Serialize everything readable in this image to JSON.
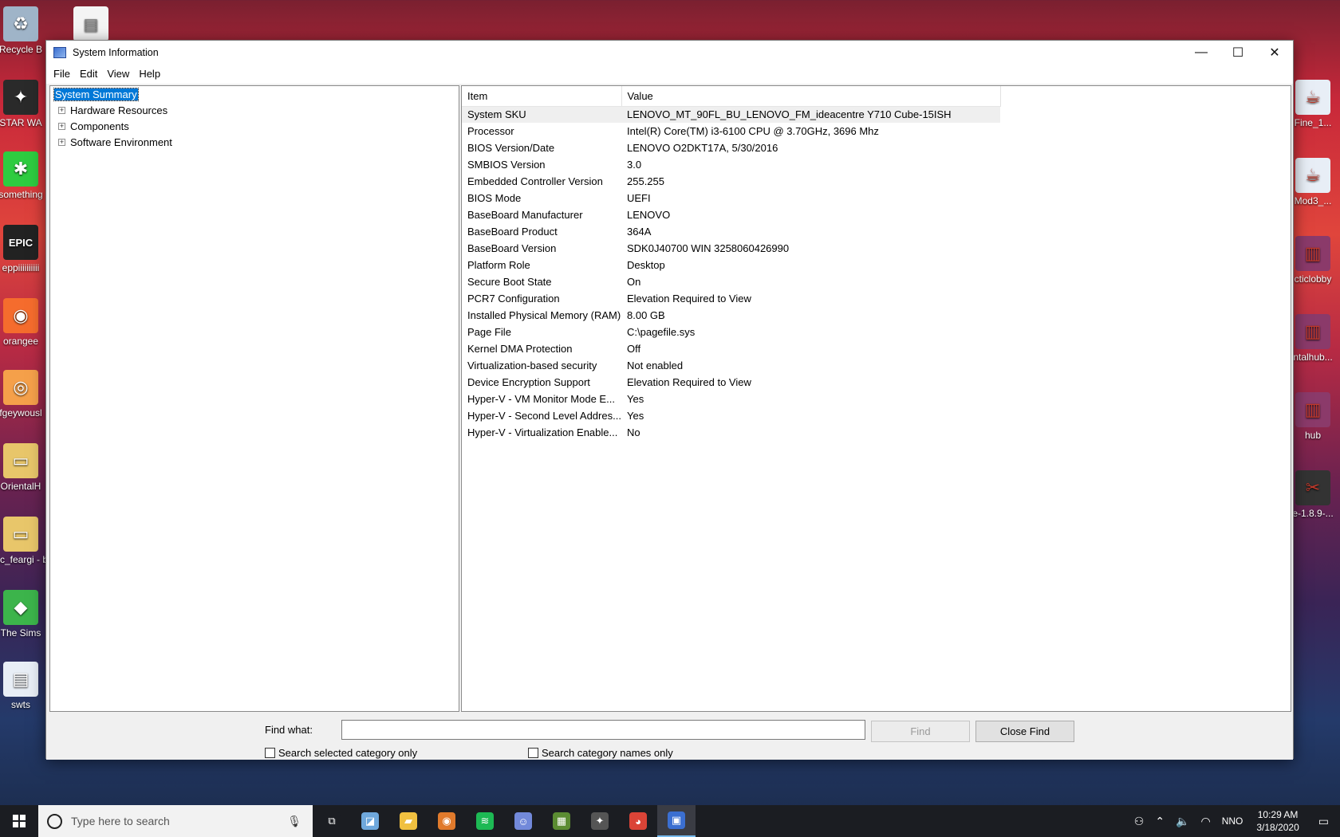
{
  "desktop": {
    "left_icons": [
      {
        "label": "Recycle B",
        "icon": "recycle-bin-icon",
        "color": "#9fb4c8",
        "glyph": "♻"
      },
      {
        "label": "STAR WA",
        "icon": "star-wars-icon",
        "color": "#2a2a2a",
        "glyph": "✦"
      },
      {
        "label": "something",
        "icon": "shortcut-app-icon",
        "color": "#2ecc40",
        "glyph": "✱"
      },
      {
        "label": "eppiiiiiiiiii",
        "icon": "epic-games-icon",
        "color": "#222222",
        "glyph": "EPIC"
      },
      {
        "label": "orangee",
        "icon": "origin-icon",
        "color": "#f56c2d",
        "glyph": "◉"
      },
      {
        "label": "fgeywousl",
        "icon": "swirl-app-icon",
        "color": "#f5a04a",
        "glyph": "◎"
      },
      {
        "label": "OrientalH",
        "icon": "folder-icon",
        "color": "#e8c66a",
        "glyph": "▭"
      },
      {
        "label": "mc_feargi - bedwars",
        "icon": "folder-icon",
        "color": "#e8c66a",
        "glyph": "▭"
      },
      {
        "label": "The Sims",
        "icon": "sims-icon",
        "color": "#3cb44b",
        "glyph": "◆"
      },
      {
        "label": "swts",
        "icon": "document-icon",
        "color": "#e8eef6",
        "glyph": "▤"
      }
    ],
    "top_icon": {
      "icon": "text-file-icon"
    },
    "right_icons": [
      {
        "label": "Fine_1...",
        "icon": "java-file-icon",
        "color": "#e8eef6",
        "glyph": "☕"
      },
      {
        "label": "Mod3_...",
        "icon": "java-file-icon",
        "color": "#e8eef6",
        "glyph": "☕"
      },
      {
        "label": "cticlobby",
        "icon": "winrar-archive-icon",
        "color": "#8b3a6a",
        "glyph": "▥"
      },
      {
        "label": "ntalhub...",
        "icon": "winrar-archive-icon",
        "color": "#8b3a6a",
        "glyph": "▥"
      },
      {
        "label": "hub",
        "icon": "winrar-archive-icon",
        "color": "#8b3a6a",
        "glyph": "▥"
      },
      {
        "label": "e-1.8.9-...",
        "icon": "jar-file-icon",
        "color": "#333333",
        "glyph": "✂"
      }
    ]
  },
  "window": {
    "title": "System Information",
    "menu": [
      "File",
      "Edit",
      "View",
      "Help"
    ],
    "controls": {
      "minimize": "—",
      "maximize": "☐",
      "close": "✕"
    }
  },
  "tree": {
    "items": [
      {
        "label": "System Summary",
        "selected": true,
        "expandable": false
      },
      {
        "label": "Hardware Resources",
        "selected": false,
        "expandable": true
      },
      {
        "label": "Components",
        "selected": false,
        "expandable": true
      },
      {
        "label": "Software Environment",
        "selected": false,
        "expandable": true
      }
    ]
  },
  "details": {
    "columns": [
      "Item",
      "Value"
    ],
    "rows": [
      [
        "System SKU",
        "LENOVO_MT_90FL_BU_LENOVO_FM_ideacentre Y710 Cube-15ISH"
      ],
      [
        "Processor",
        "Intel(R) Core(TM) i3-6100 CPU @ 3.70GHz, 3696 Mhz"
      ],
      [
        "BIOS Version/Date",
        "LENOVO O2DKT17A, 5/30/2016"
      ],
      [
        "SMBIOS Version",
        "3.0"
      ],
      [
        "Embedded Controller Version",
        "255.255"
      ],
      [
        "BIOS Mode",
        "UEFI"
      ],
      [
        "BaseBoard Manufacturer",
        "LENOVO"
      ],
      [
        "BaseBoard Product",
        "364A"
      ],
      [
        "BaseBoard Version",
        "SDK0J40700 WIN 3258060426990"
      ],
      [
        "Platform Role",
        "Desktop"
      ],
      [
        "Secure Boot State",
        "On"
      ],
      [
        "PCR7 Configuration",
        "Elevation Required to View"
      ],
      [
        "Installed Physical Memory (RAM)",
        "8.00 GB"
      ],
      [
        "Page File",
        "C:\\pagefile.sys"
      ],
      [
        "Kernel DMA Protection",
        "Off"
      ],
      [
        "Virtualization-based security",
        "Not enabled"
      ],
      [
        "Device Encryption Support",
        "Elevation Required to View"
      ],
      [
        "Hyper-V - VM Monitor Mode E...",
        "Yes"
      ],
      [
        "Hyper-V - Second Level Addres...",
        "Yes"
      ],
      [
        "Hyper-V - Virtualization Enable...",
        "No"
      ]
    ]
  },
  "find": {
    "label": "Find what:",
    "value": "",
    "find_button": "Find",
    "close_button": "Close Find",
    "check_selected": "Search selected category only",
    "check_names": "Search category names only"
  },
  "taskbar": {
    "search_placeholder": "Type here to search",
    "apps": [
      {
        "icon": "task-view-icon",
        "glyph": "⧉",
        "color": "#1b1d22"
      },
      {
        "icon": "notes-app-icon",
        "glyph": "◪",
        "color": "#6fa8dc"
      },
      {
        "icon": "file-explorer-icon",
        "glyph": "▰",
        "color": "#f0c040"
      },
      {
        "icon": "groove-music-icon",
        "glyph": "◉",
        "color": "#e07a2c"
      },
      {
        "icon": "spotify-icon",
        "glyph": "≋",
        "color": "#1db954"
      },
      {
        "icon": "discord-icon",
        "glyph": "☺",
        "color": "#7289da"
      },
      {
        "icon": "minecraft-icon",
        "glyph": "▦",
        "color": "#5b8c32"
      },
      {
        "icon": "star-wars-game-icon",
        "glyph": "✦",
        "color": "#555555"
      },
      {
        "icon": "chrome-icon",
        "glyph": "◕",
        "color": "#db4437"
      },
      {
        "icon": "system-information-icon",
        "glyph": "▣",
        "color": "#3b6fd1",
        "active": true
      }
    ],
    "language": "NNO",
    "time": "10:29 AM",
    "date": "3/18/2020"
  }
}
